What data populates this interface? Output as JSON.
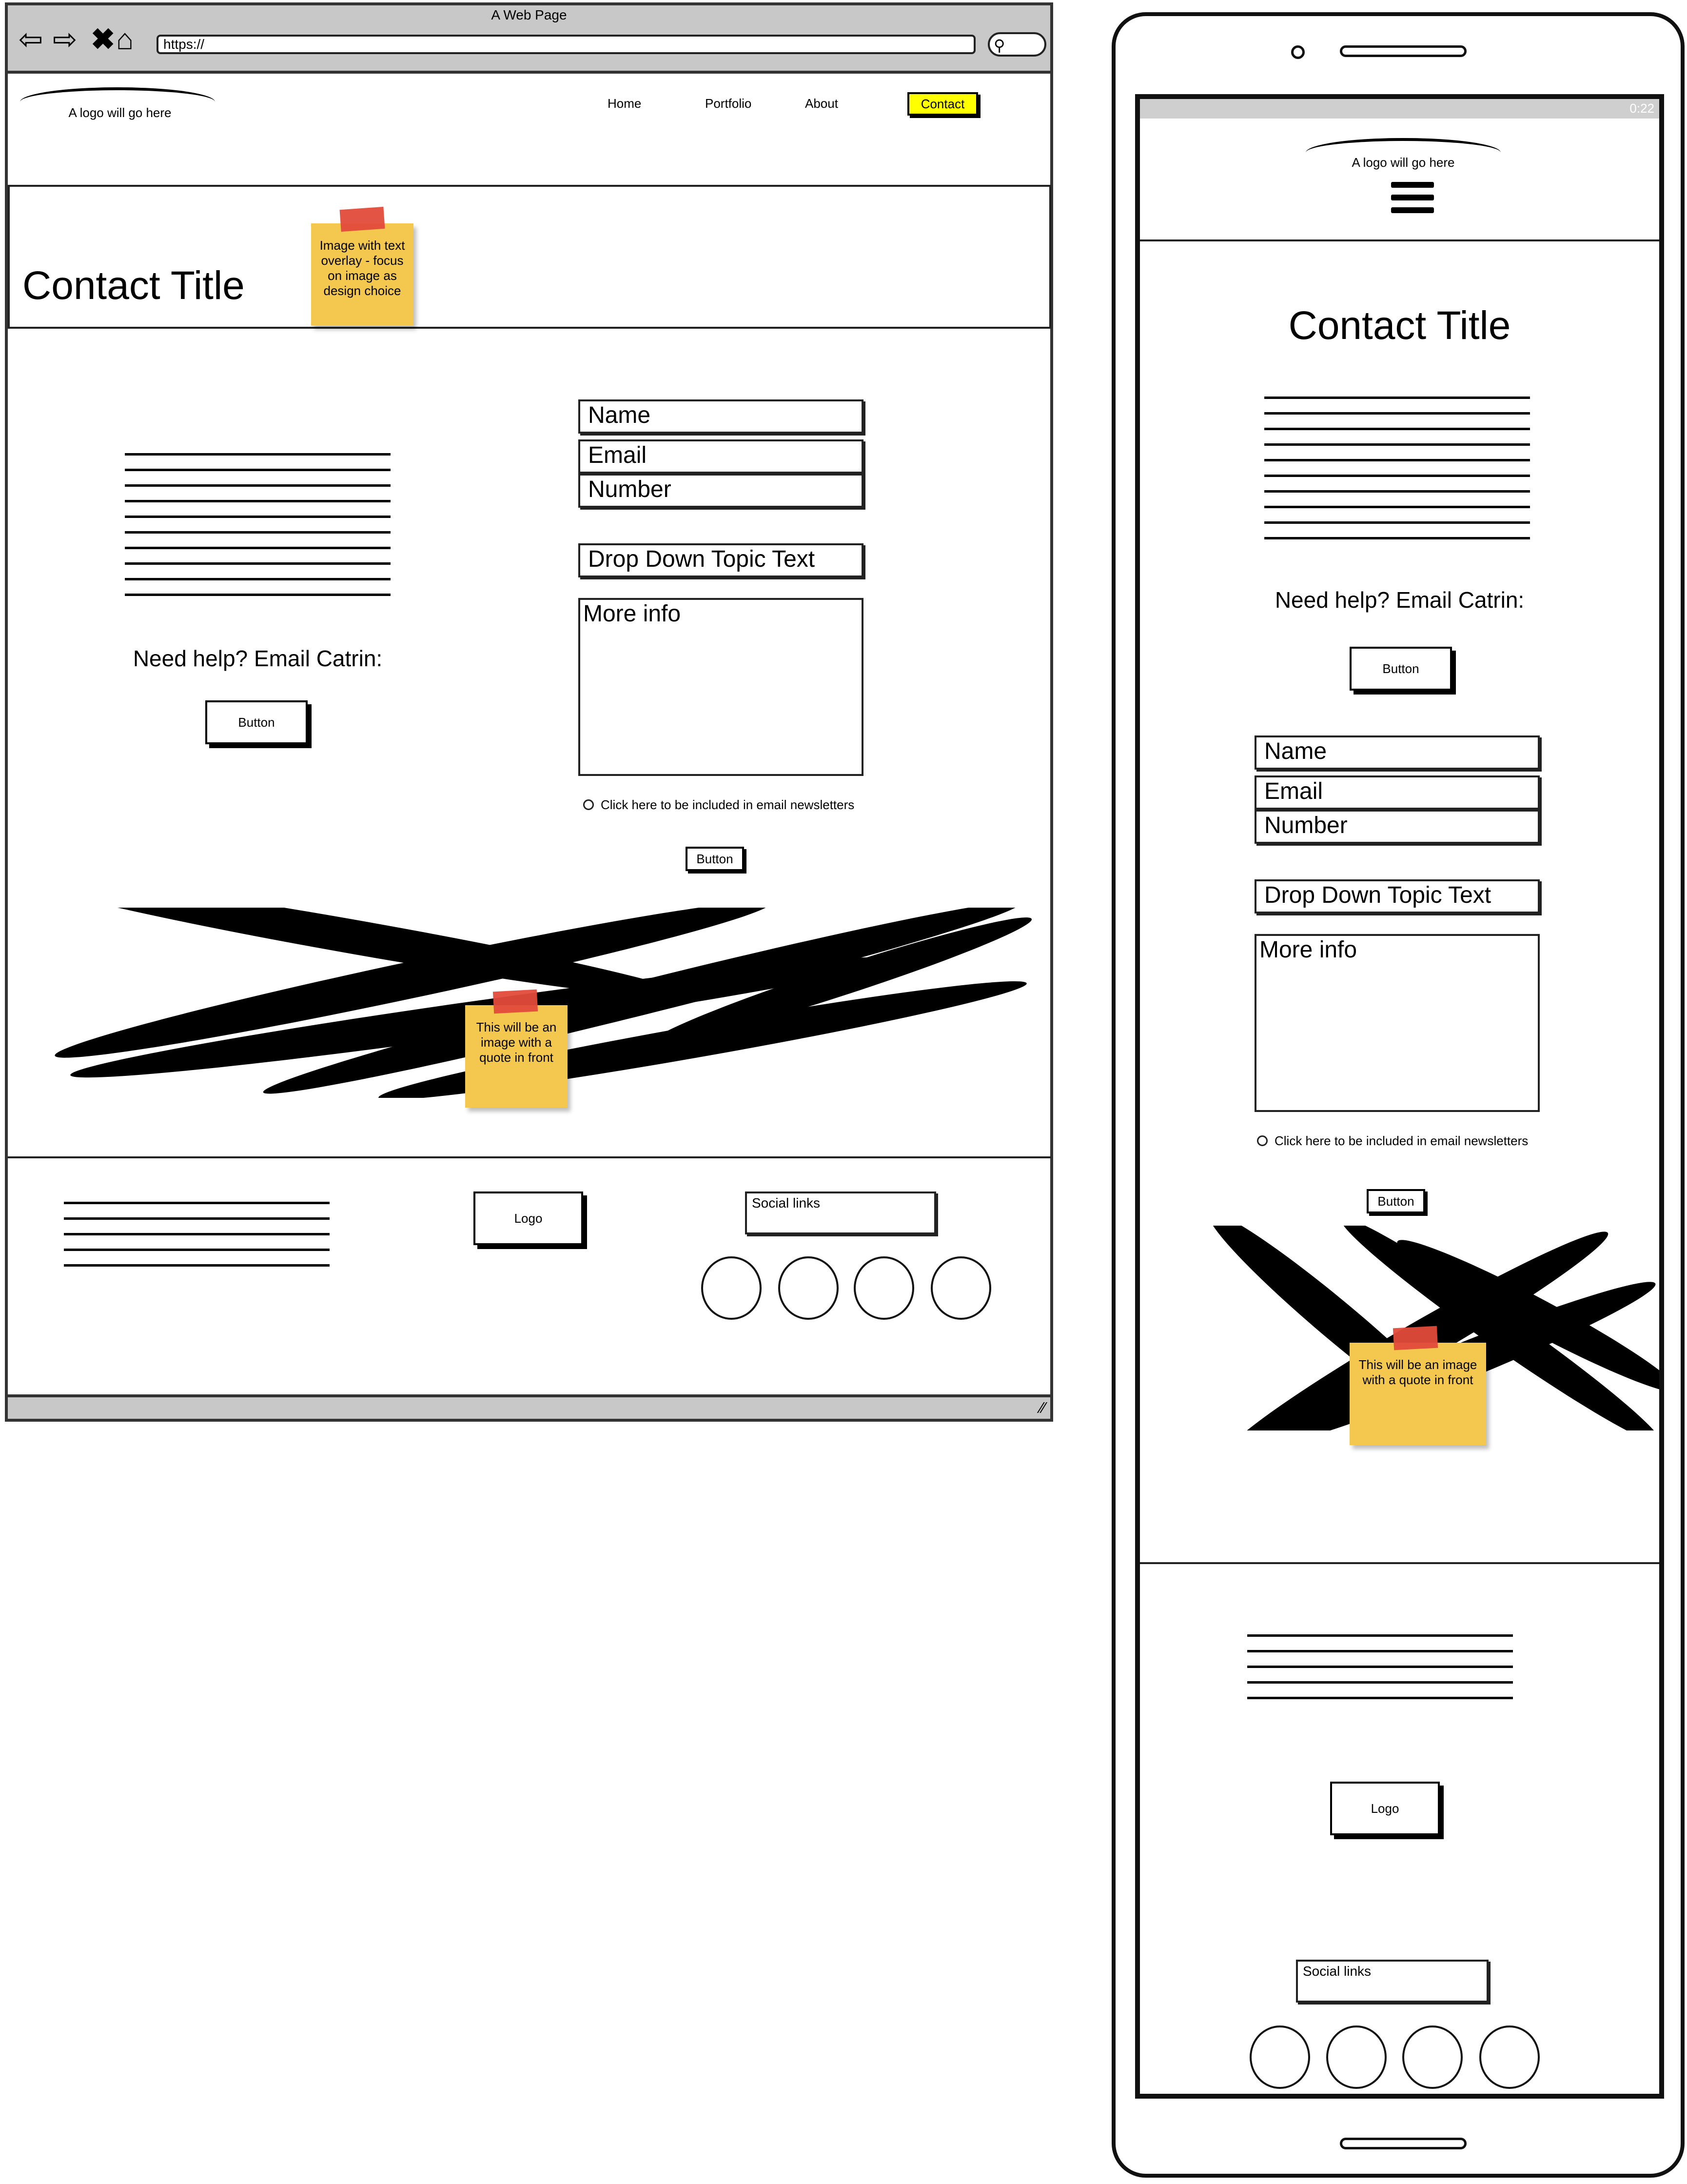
{
  "browser": {
    "title": "A Web Page",
    "url": "https://",
    "back_icon": "back-arrow-icon",
    "forward_icon": "forward-arrow-icon",
    "stop_icon": "close-icon",
    "home_icon": "home-icon",
    "search_icon": "search-icon"
  },
  "site": {
    "logo_text": "A logo will go here",
    "nav": {
      "home": "Home",
      "portfolio": "Portfolio",
      "about": "About",
      "contact": "Contact"
    },
    "nav_active_color": "#ffff00",
    "hero": {
      "title": "Contact Title",
      "sticky_note": "Image with text overlay - focus on image as design choice"
    },
    "help_text": "Need help? Email Catrin:",
    "button_label": "Button",
    "form": {
      "name": "Name",
      "email": "Email",
      "number": "Number",
      "topic": "Drop Down Topic Text",
      "more_info": "More info",
      "newsletter": "Click here to be included in email newsletters",
      "submit": "Button"
    },
    "quote_sticky": "This will be an image with a quote in front",
    "quote_sticky_mobile": "This will be an image with a quote in front",
    "footer": {
      "logo": "Logo",
      "social_links": "Social links"
    },
    "sticky_color": "#f4c84f"
  },
  "phone": {
    "status_time": "0:22"
  }
}
